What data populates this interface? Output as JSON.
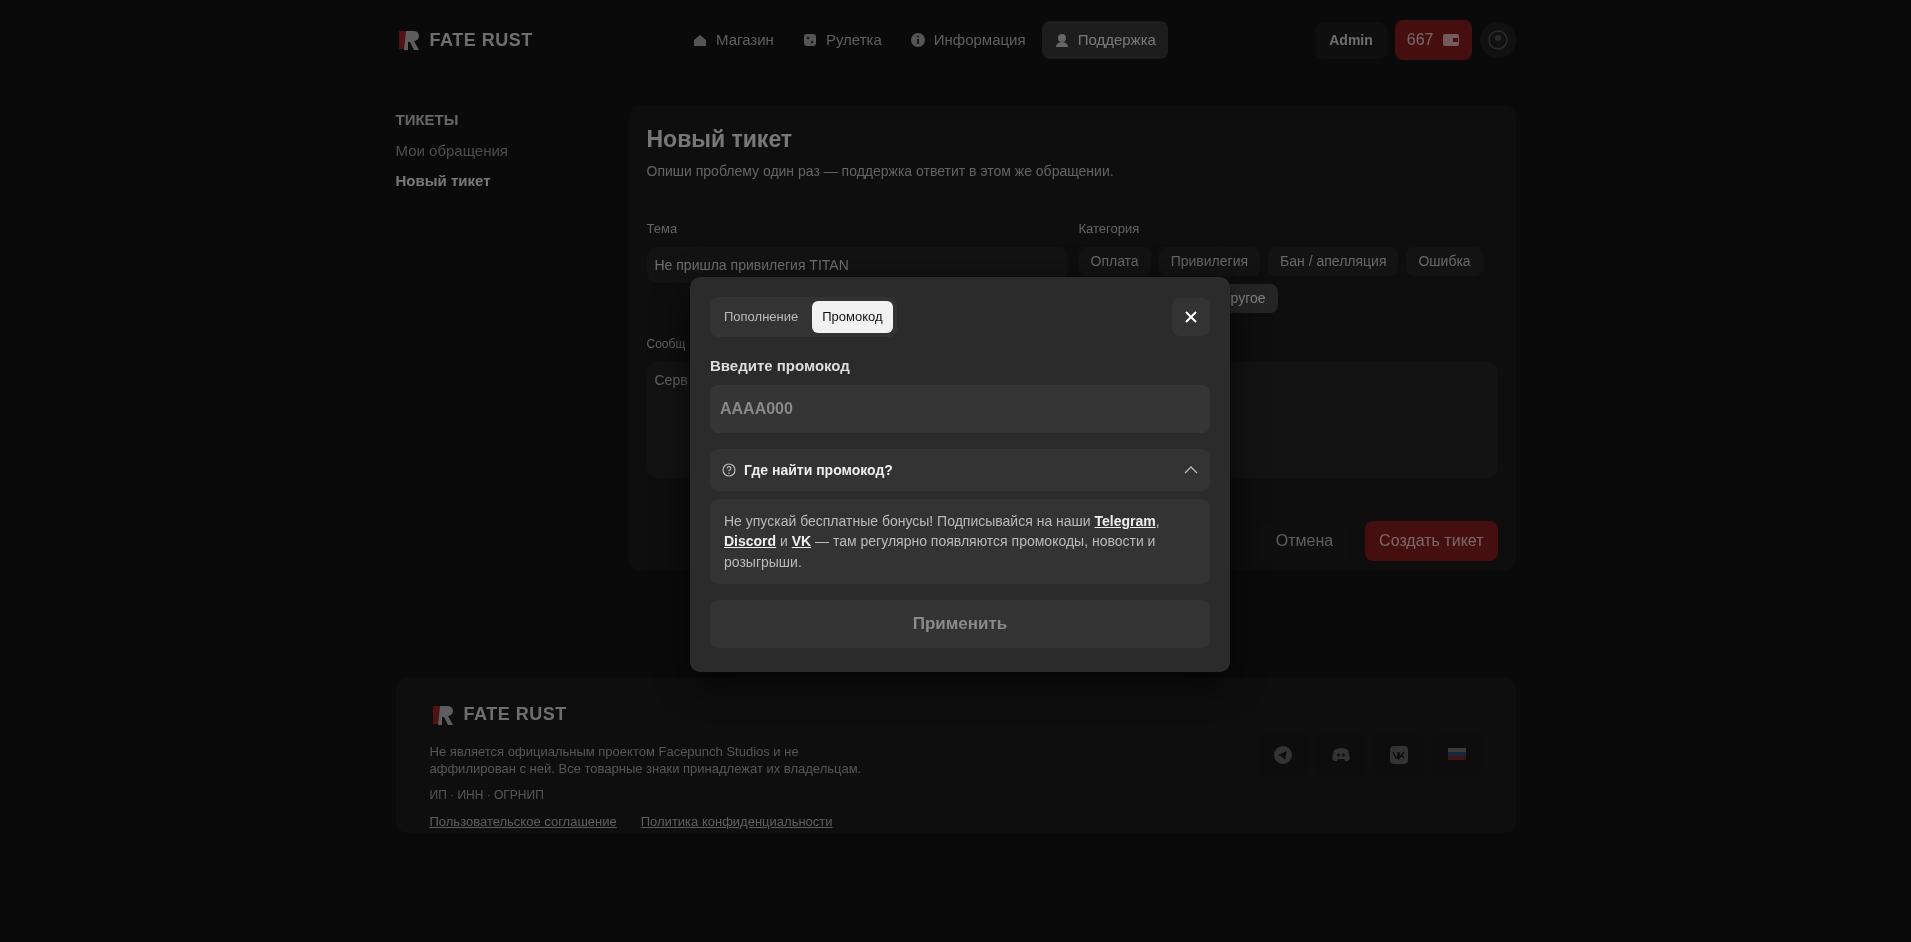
{
  "header": {
    "logo": "FATE RUST",
    "nav": [
      {
        "label": "Магазин",
        "selected": false
      },
      {
        "label": "Рулетка",
        "selected": false
      },
      {
        "label": "Информация",
        "selected": false
      },
      {
        "label": "Поддержка",
        "selected": true
      }
    ],
    "user": "Admin",
    "balance": "667"
  },
  "sidebar": {
    "heading": "ТИКЕТЫ",
    "items": [
      {
        "label": "Мои обращения",
        "selected": false
      },
      {
        "label": "Новый тикет",
        "selected": true
      }
    ]
  },
  "ticket_form": {
    "title": "Новый тикет",
    "subtitle": "Опиши проблему один раз — поддержка ответит в этом же обращении.",
    "subject": {
      "label": "Тема",
      "value": "Не пришла привилегия TITAN"
    },
    "category": {
      "label": "Категория",
      "options": [
        {
          "label": "Оплата",
          "selected": false
        },
        {
          "label": "Привилегия",
          "selected": false
        },
        {
          "label": "Бан / апелляция",
          "selected": false
        },
        {
          "label": "Ошибка",
          "selected": false
        },
        {
          "label": "ругое",
          "selected": true
        }
      ]
    },
    "message": {
      "label": "Сообщ",
      "placeholder": "Серв"
    },
    "cancel": "Отмена",
    "submit": "Создать тикет"
  },
  "footer": {
    "logo": "FATE RUST",
    "disclaimer": "Не является официальным проектом Facepunch Studios и не аффилирован с ней. Все товарные знаки принадлежат их владельцам.",
    "legal": "ИП · ИНН · ОГРНИП",
    "links": [
      "Пользовательское соглашение",
      "Политика конфиденциальности"
    ],
    "socials": [
      {
        "kind": "telegram"
      },
      {
        "kind": "discord"
      },
      {
        "kind": "vk"
      },
      {
        "kind": "flag"
      }
    ]
  },
  "modal": {
    "tabs": [
      {
        "label": "Пополнение",
        "selected": false
      },
      {
        "label": "Промокод",
        "selected": true
      }
    ],
    "field": {
      "label": "Введите промокод",
      "placeholder": "AAAA000"
    },
    "faq": {
      "question": "Где найти промокод?",
      "expanded": true,
      "answer": [
        {
          "kind": "text",
          "text": "Не упускай бесплатные бонусы! Подписывайся на наши "
        },
        {
          "kind": "link",
          "text": "Telegram"
        },
        {
          "kind": "text",
          "text": ", "
        },
        {
          "kind": "link",
          "text": "Discord"
        },
        {
          "kind": "text",
          "text": " и "
        },
        {
          "kind": "link",
          "text": "VK"
        },
        {
          "kind": "text",
          "text": " — там регулярно появляются промокоды, новости и розыгрыши."
        }
      ]
    },
    "apply": {
      "label": "Применить",
      "disabled": true
    }
  }
}
